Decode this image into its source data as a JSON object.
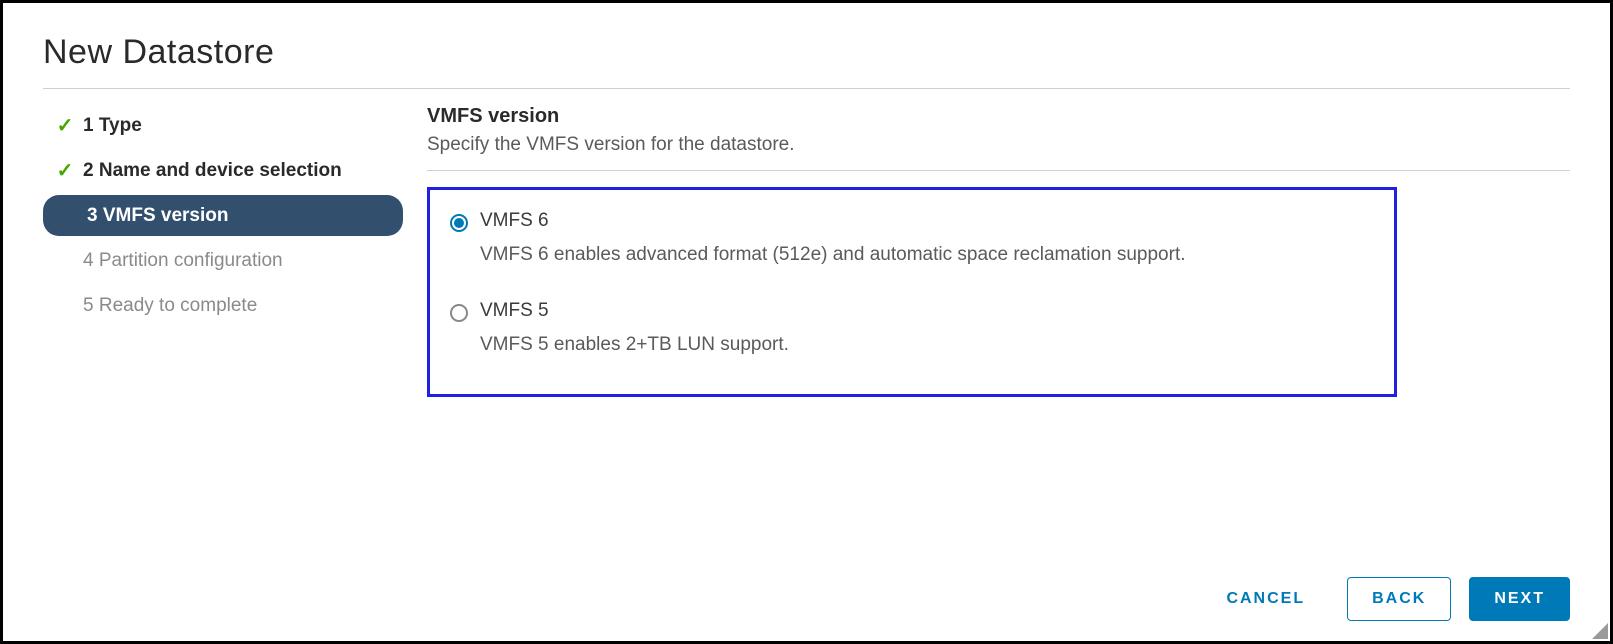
{
  "title": "New Datastore",
  "wizard": {
    "steps": [
      {
        "label": "1 Type",
        "state": "completed"
      },
      {
        "label": "2 Name and device selection",
        "state": "completed"
      },
      {
        "label": "3 VMFS version",
        "state": "active"
      },
      {
        "label": "4 Partition configuration",
        "state": "pending"
      },
      {
        "label": "5 Ready to complete",
        "state": "pending"
      }
    ]
  },
  "section": {
    "title": "VMFS version",
    "description": "Specify the VMFS version for the datastore."
  },
  "options": [
    {
      "label": "VMFS 6",
      "description": "VMFS 6 enables advanced format (512e) and automatic space reclamation support.",
      "selected": true
    },
    {
      "label": "VMFS 5",
      "description": "VMFS 5 enables 2+TB LUN support.",
      "selected": false
    }
  ],
  "footer": {
    "cancel": "CANCEL",
    "back": "BACK",
    "next": "NEXT"
  }
}
